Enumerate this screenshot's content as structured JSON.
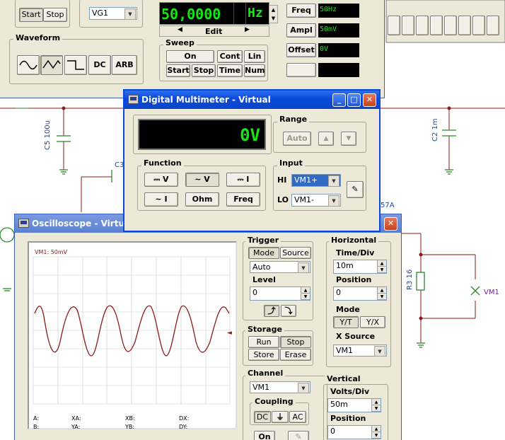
{
  "function_generator": {
    "start_label": "Start",
    "stop_label": "Stop",
    "source_select": "VG1",
    "waveform_label": "Waveform",
    "dc_label": "DC",
    "arb_label": "ARB",
    "display_value": "50,0000",
    "display_unit": "Hz",
    "edit_label": "Edit",
    "sweep_label": "Sweep",
    "sweep_buttons": [
      "On",
      "Cont",
      "Lin",
      "Start",
      "Stop",
      "Time",
      "Num"
    ],
    "freq_label": "Freq",
    "freq_value": "50Hz",
    "ampl_label": "Ampl",
    "ampl_value": "50mV",
    "offset_label": "Offset",
    "offset_value": "0V"
  },
  "multimeter": {
    "title": "Digital Multimeter - Virtual",
    "display": "0V",
    "range_label": "Range",
    "auto_label": "Auto",
    "function_label": "Function",
    "functions": [
      "V",
      "V",
      "I",
      "I",
      "Ohm",
      "Freq"
    ],
    "input_label": "Input",
    "hi_label": "HI",
    "hi_value": "VM1+",
    "lo_label": "LO",
    "lo_value": "VM1-"
  },
  "oscilloscope": {
    "title": "Oscilloscope - Virtua",
    "screen_label": "VM1: 50mV",
    "trigger_label": "Trigger",
    "mode_label": "Mode",
    "source_label": "Source",
    "trigger_mode": "Auto",
    "level_label": "Level",
    "level_value": "0",
    "storage_label": "Storage",
    "run_label": "Run",
    "stop_label": "Stop",
    "store_label": "Store",
    "erase_label": "Erase",
    "channel_label": "Channel",
    "channel_value": "VM1",
    "coupling_label": "Coupling",
    "dc_label": "DC",
    "ac_label": "AC",
    "on_label": "On",
    "horizontal_label": "Horizontal",
    "time_div_label": "Time/Div",
    "time_div_value": "10m",
    "h_position_label": "Position",
    "h_position_value": "0",
    "h_mode_label": "Mode",
    "yt_label": "Y/T",
    "yx_label": "Y/X",
    "xsource_label": "X Source",
    "xsource_value": "VM1",
    "vertical_label": "Vertical",
    "volts_div_label": "Volts/Div",
    "volts_div_value": "50m",
    "v_position_label": "Position",
    "v_position_value": "0",
    "readout": {
      "a": "A:",
      "b": "B:",
      "xa": "XA:",
      "ya": "YA:",
      "xb": "XB:",
      "yb": "YB:",
      "dx": "DX:",
      "dy": "DY:"
    }
  },
  "circuit": {
    "c5": "C5 100u",
    "c2": "C2 1m",
    "c3": "C3",
    "r3": "R3 16",
    "vm1": "VM1",
    "probe": "57A"
  }
}
